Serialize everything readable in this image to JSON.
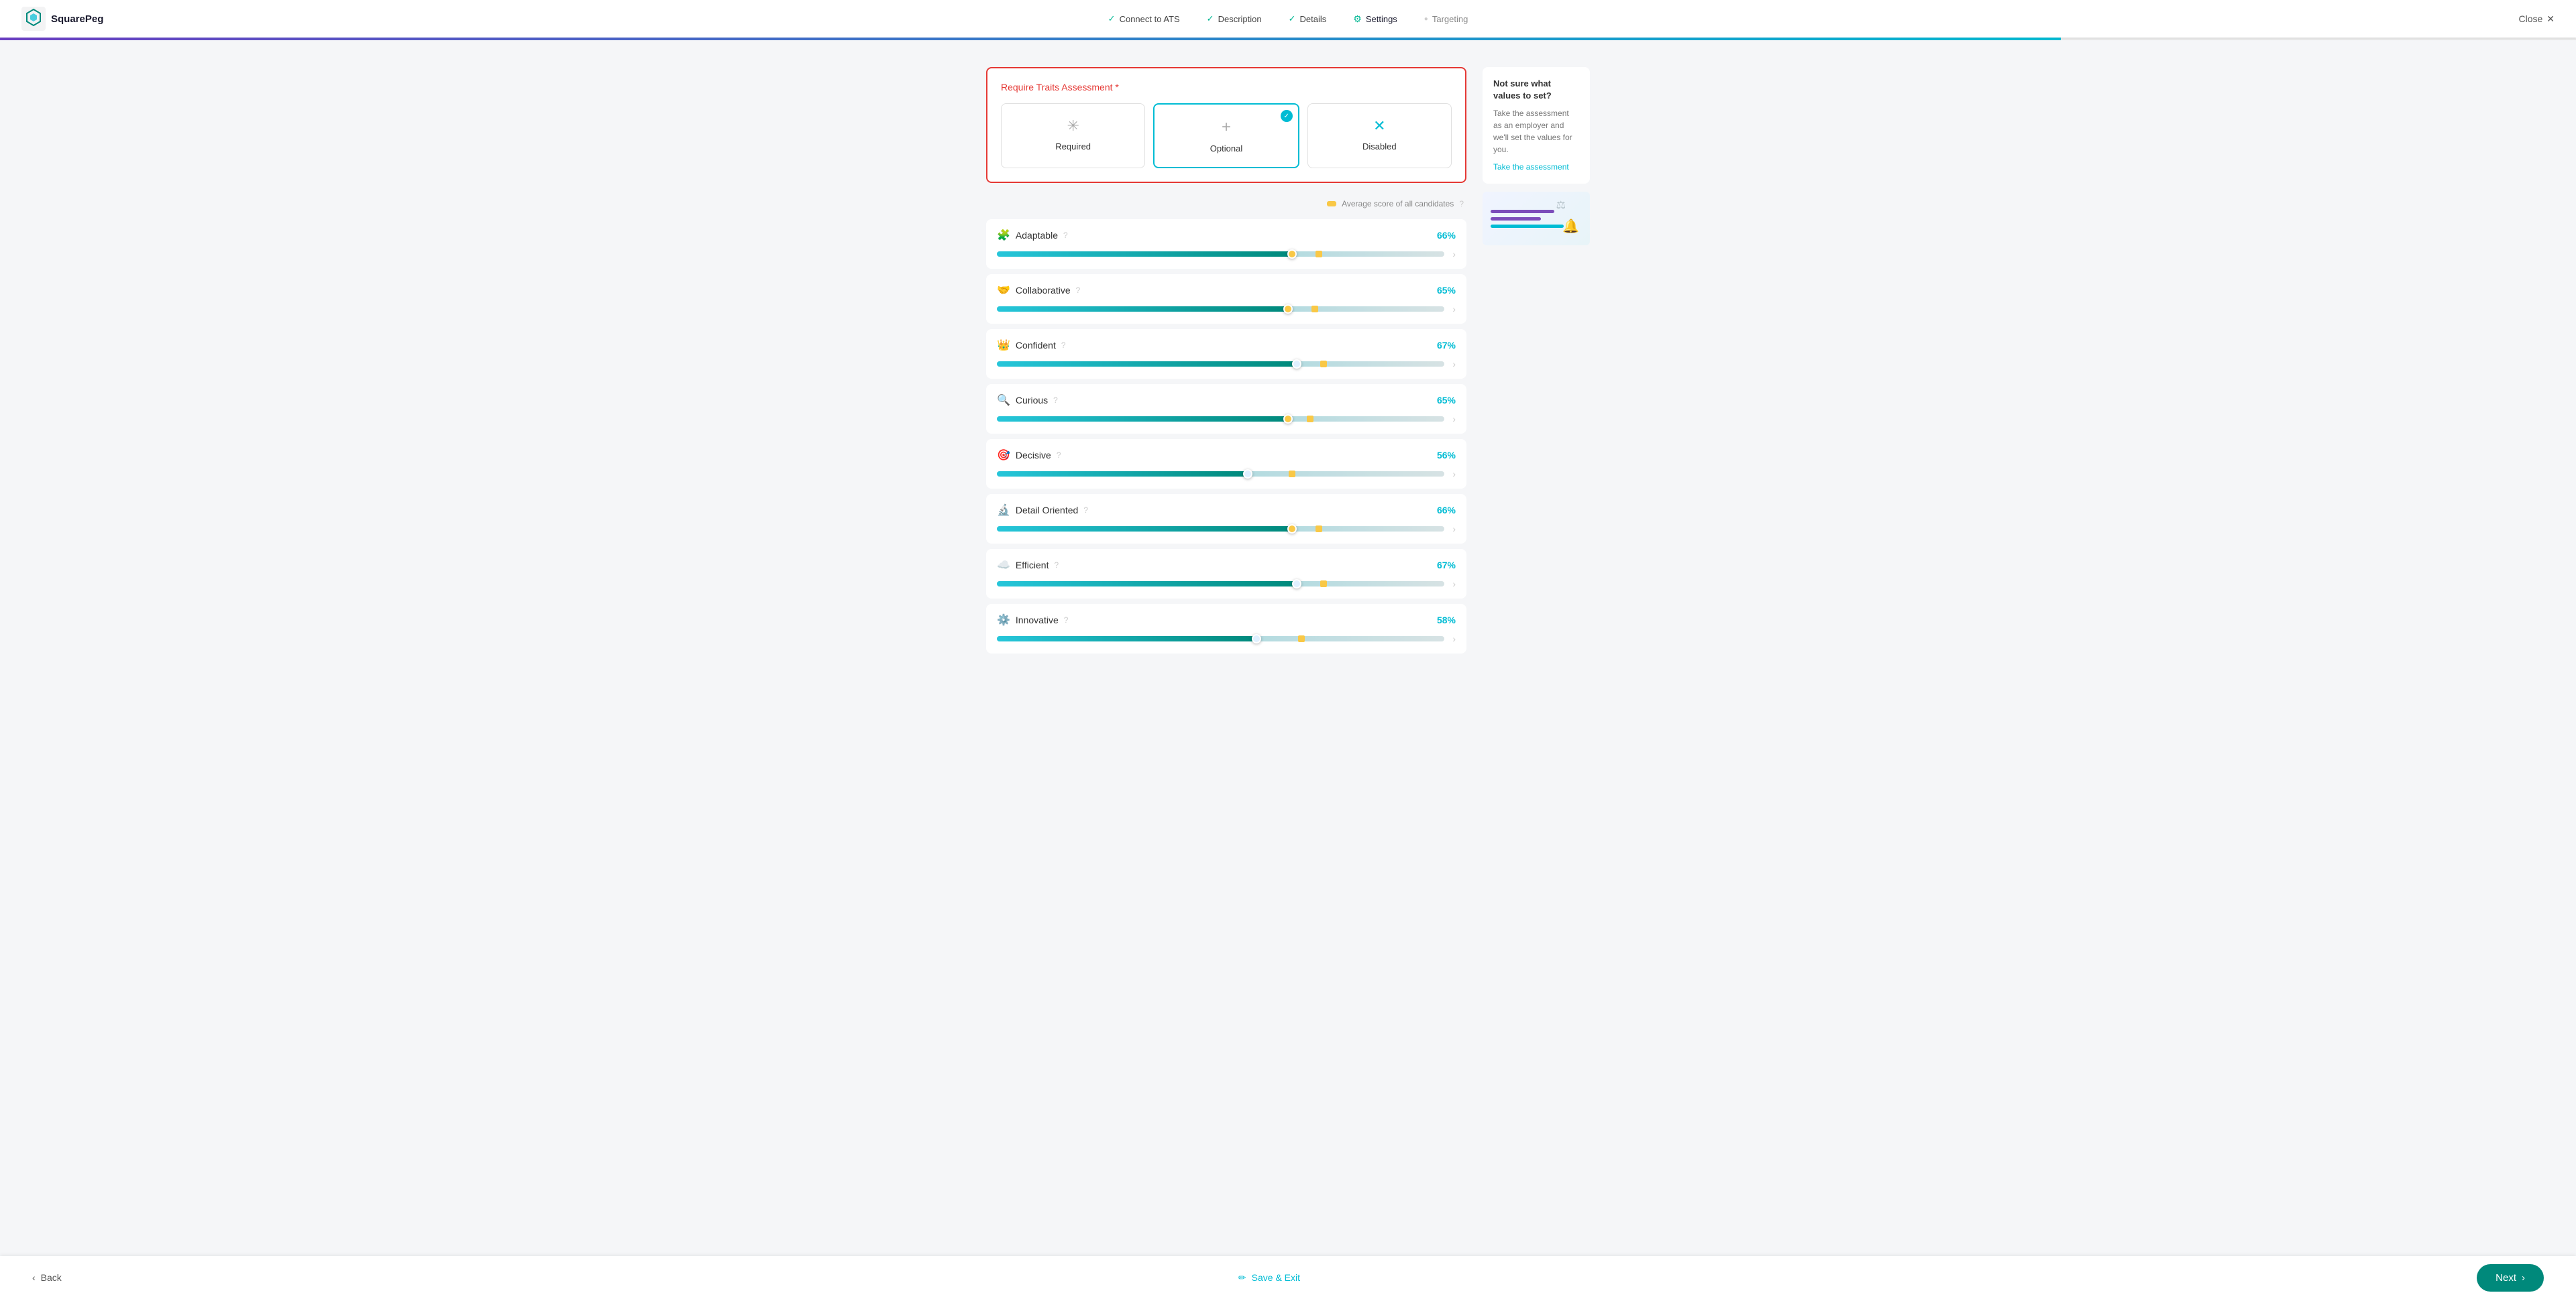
{
  "header": {
    "logo_text": "SquarePeg",
    "close_label": "Close",
    "steps": [
      {
        "id": "connect",
        "label": "Connect to ATS",
        "state": "completed"
      },
      {
        "id": "description",
        "label": "Description",
        "state": "completed"
      },
      {
        "id": "details",
        "label": "Details",
        "state": "completed"
      },
      {
        "id": "settings",
        "label": "Settings",
        "state": "active"
      },
      {
        "id": "targeting",
        "label": "Targeting",
        "state": "inactive"
      }
    ],
    "progress_pct": 80
  },
  "traits_assessment": {
    "label": "Require Traits Assessment",
    "required_marker": "*",
    "options": [
      {
        "id": "required",
        "label": "Required",
        "icon": "✳",
        "selected": false
      },
      {
        "id": "optional",
        "label": "Optional",
        "icon": "+",
        "selected": true
      },
      {
        "id": "disabled",
        "label": "Disabled",
        "icon": "✕",
        "selected": false
      }
    ]
  },
  "slider_header": {
    "avg_label": "Average score of all candidates",
    "info": "?"
  },
  "traits": [
    {
      "id": "adaptable",
      "name": "Adaptable",
      "icon": "🧩",
      "pct": "66%",
      "fill_pct": 66,
      "avg_pct": 72,
      "thumb_color": "#f9c846",
      "fill_gradient": [
        "#00bcd4",
        "#00897b"
      ]
    },
    {
      "id": "collaborative",
      "name": "Collaborative",
      "icon": "🤝",
      "pct": "65%",
      "fill_pct": 65,
      "avg_pct": 71,
      "thumb_color": "#f9c846",
      "fill_gradient": [
        "#00bcd4",
        "#00897b"
      ]
    },
    {
      "id": "confident",
      "name": "Confident",
      "icon": "👑",
      "pct": "67%",
      "fill_pct": 67,
      "avg_pct": 73,
      "thumb_color": "#e0f0ff",
      "fill_gradient": [
        "#00bcd4",
        "#00897b"
      ]
    },
    {
      "id": "curious",
      "name": "Curious",
      "icon": "🔍",
      "pct": "65%",
      "fill_pct": 65,
      "avg_pct": 70,
      "thumb_color": "#f9c846",
      "fill_gradient": [
        "#00bcd4",
        "#00897b"
      ]
    },
    {
      "id": "decisive",
      "name": "Decisive",
      "icon": "🎯",
      "pct": "56%",
      "fill_pct": 56,
      "avg_pct": 66,
      "thumb_color": "#e0f0ff",
      "fill_gradient": [
        "#00bcd4",
        "#00897b"
      ]
    },
    {
      "id": "detail-oriented",
      "name": "Detail Oriented",
      "icon": "🔬",
      "pct": "66%",
      "fill_pct": 66,
      "avg_pct": 72,
      "thumb_color": "#f9c846",
      "fill_gradient": [
        "#00bcd4",
        "#00897b"
      ]
    },
    {
      "id": "efficient",
      "name": "Efficient",
      "icon": "☁️",
      "pct": "67%",
      "fill_pct": 67,
      "avg_pct": 73,
      "thumb_color": "#e0f0ff",
      "fill_gradient": [
        "#00bcd4",
        "#00897b"
      ]
    },
    {
      "id": "innovative",
      "name": "Innovative",
      "icon": "⚙️",
      "pct": "58%",
      "fill_pct": 58,
      "avg_pct": 68,
      "thumb_color": "#e0f0ff",
      "fill_gradient": [
        "#00bcd4",
        "#00897b"
      ]
    }
  ],
  "sidebar": {
    "info_title": "Not sure what values to set?",
    "info_desc": "Take the assessment as an employer and we'll set the values for you.",
    "info_link": "Take the assessment",
    "illus_lines": [
      {
        "width": "70%",
        "color": "#7c4dba"
      },
      {
        "width": "55%",
        "color": "#7c4dba"
      },
      {
        "width": "80%",
        "color": "#00bcd4"
      }
    ]
  },
  "footer": {
    "back_label": "Back",
    "save_exit_label": "Save & Exit",
    "next_label": "Next"
  }
}
